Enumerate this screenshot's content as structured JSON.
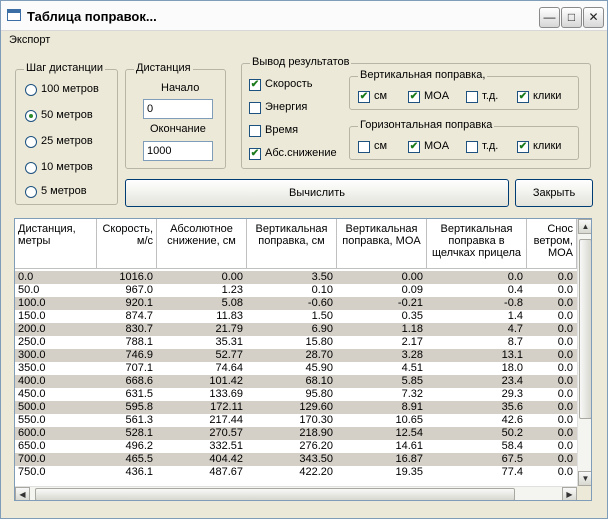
{
  "window": {
    "title": "Таблица поправок..."
  },
  "menu": {
    "export": "Экспорт"
  },
  "step_group": {
    "legend": "Шаг дистанции",
    "options": [
      {
        "label": "100 метров",
        "selected": false
      },
      {
        "label": "50 метров",
        "selected": true
      },
      {
        "label": "25 метров",
        "selected": false
      },
      {
        "label": "10 метров",
        "selected": false
      },
      {
        "label": "5 метров",
        "selected": false
      }
    ]
  },
  "distance_group": {
    "legend": "Дистанция",
    "start_label": "Начало",
    "start_value": "0",
    "end_label": "Окончание",
    "end_value": "1000"
  },
  "output_group": {
    "legend": "Вывод результатов",
    "options": [
      {
        "label": "Скорость",
        "checked": true
      },
      {
        "label": "Энергия",
        "checked": false
      },
      {
        "label": "Время",
        "checked": false
      },
      {
        "label": "Абс.снижение",
        "checked": true
      }
    ],
    "vertical": {
      "legend": "Вертикальная поправка,",
      "options": [
        {
          "label": "см",
          "checked": true
        },
        {
          "label": "MOA",
          "checked": true
        },
        {
          "label": "т.д.",
          "checked": false
        },
        {
          "label": "клики",
          "checked": true
        }
      ]
    },
    "horizontal": {
      "legend": "Горизонтальная поправка",
      "options": [
        {
          "label": "см",
          "checked": false
        },
        {
          "label": "MOA",
          "checked": true
        },
        {
          "label": "т.д.",
          "checked": false
        },
        {
          "label": "клики",
          "checked": true
        }
      ]
    }
  },
  "buttons": {
    "calculate": "Вычислить",
    "close": "Закрыть"
  },
  "table": {
    "headers": [
      "Дистанция, метры",
      "Скорость, м/с",
      "Абсолютное снижение, см",
      "Вертикальная поправка, см",
      "Вертикальная поправка, MOA",
      "Вертикальная поправка в щелчках прицела",
      "Снос ветром, MOA"
    ],
    "rows": [
      [
        "0.0",
        "1016.0",
        "0.00",
        "3.50",
        "0.00",
        "0.0",
        "0.0"
      ],
      [
        "50.0",
        "967.0",
        "1.23",
        "0.10",
        "0.09",
        "0.4",
        "0.0"
      ],
      [
        "100.0",
        "920.1",
        "5.08",
        "-0.60",
        "-0.21",
        "-0.8",
        "0.0"
      ],
      [
        "150.0",
        "874.7",
        "11.83",
        "1.50",
        "0.35",
        "1.4",
        "0.0"
      ],
      [
        "200.0",
        "830.7",
        "21.79",
        "6.90",
        "1.18",
        "4.7",
        "0.0"
      ],
      [
        "250.0",
        "788.1",
        "35.31",
        "15.80",
        "2.17",
        "8.7",
        "0.0"
      ],
      [
        "300.0",
        "746.9",
        "52.77",
        "28.70",
        "3.28",
        "13.1",
        "0.0"
      ],
      [
        "350.0",
        "707.1",
        "74.64",
        "45.90",
        "4.51",
        "18.0",
        "0.0"
      ],
      [
        "400.0",
        "668.6",
        "101.42",
        "68.10",
        "5.85",
        "23.4",
        "0.0"
      ],
      [
        "450.0",
        "631.5",
        "133.69",
        "95.80",
        "7.32",
        "29.3",
        "0.0"
      ],
      [
        "500.0",
        "595.8",
        "172.11",
        "129.60",
        "8.91",
        "35.6",
        "0.0"
      ],
      [
        "550.0",
        "561.3",
        "217.44",
        "170.30",
        "10.65",
        "42.6",
        "0.0"
      ],
      [
        "600.0",
        "528.1",
        "270.57",
        "218.90",
        "12.54",
        "50.2",
        "0.0"
      ],
      [
        "650.0",
        "496.2",
        "332.51",
        "276.20",
        "14.61",
        "58.4",
        "0.0"
      ],
      [
        "700.0",
        "465.5",
        "404.42",
        "343.50",
        "16.87",
        "67.5",
        "0.0"
      ],
      [
        "750.0",
        "436.1",
        "487.67",
        "422.20",
        "19.35",
        "77.4",
        "0.0"
      ]
    ]
  }
}
